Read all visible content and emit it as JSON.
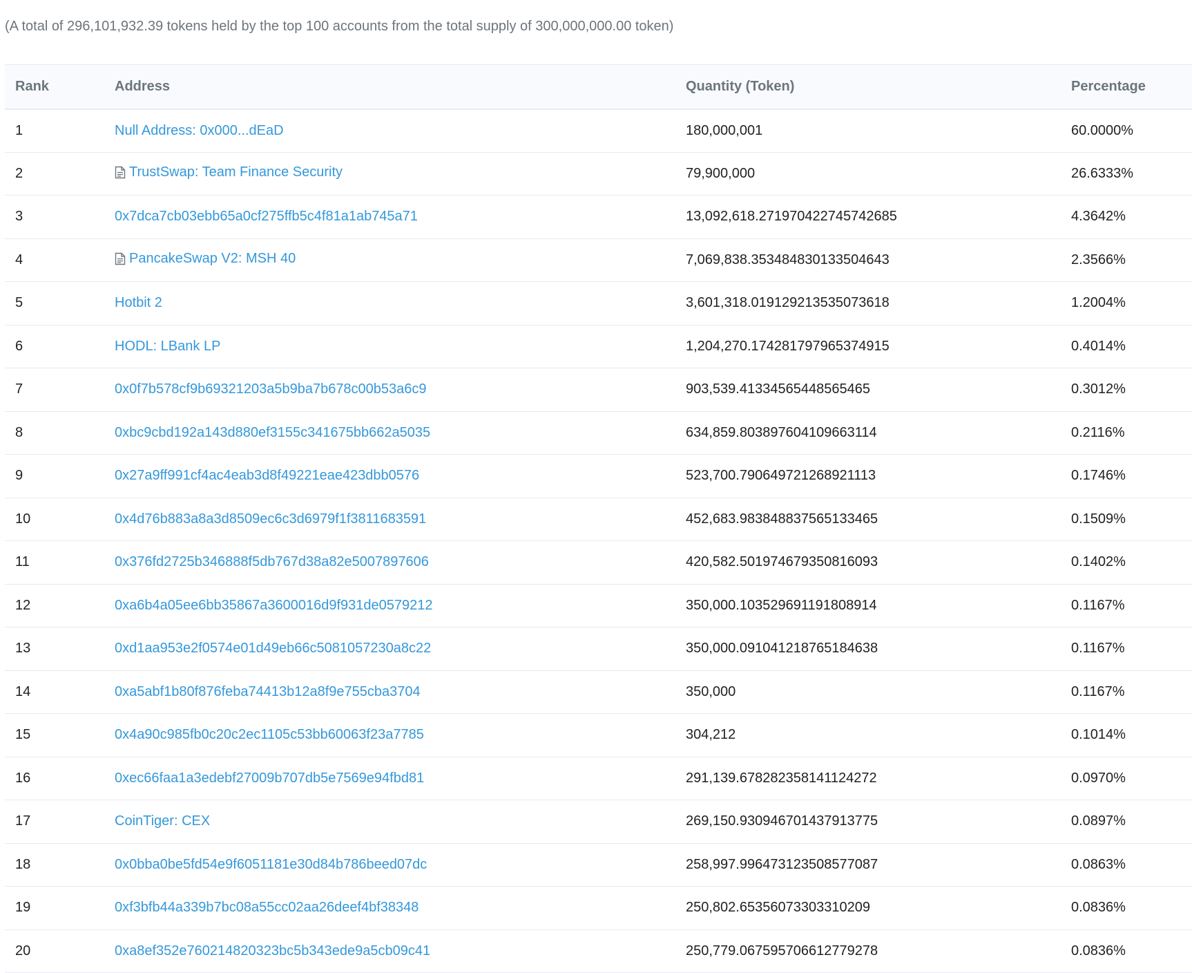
{
  "summary": "(A total of 296,101,932.39 tokens held by the top 100 accounts from the total supply of 300,000,000.00 token)",
  "table": {
    "headers": {
      "rank": "Rank",
      "address": "Address",
      "quantity": "Quantity (Token)",
      "percentage": "Percentage"
    },
    "rows": [
      {
        "rank": "1",
        "address": "Null Address: 0x000...dEaD",
        "contract": false,
        "quantity": "180,000,001",
        "percentage": "60.0000%"
      },
      {
        "rank": "2",
        "address": "TrustSwap: Team Finance Security",
        "contract": true,
        "quantity": "79,900,000",
        "percentage": "26.6333%"
      },
      {
        "rank": "3",
        "address": "0x7dca7cb03ebb65a0cf275ffb5c4f81a1ab745a71",
        "contract": false,
        "quantity": "13,092,618.271970422745742685",
        "percentage": "4.3642%"
      },
      {
        "rank": "4",
        "address": "PancakeSwap V2: MSH 40",
        "contract": true,
        "quantity": "7,069,838.353484830133504643",
        "percentage": "2.3566%"
      },
      {
        "rank": "5",
        "address": "Hotbit 2",
        "contract": false,
        "quantity": "3,601,318.019129213535073618",
        "percentage": "1.2004%"
      },
      {
        "rank": "6",
        "address": "HODL: LBank LP",
        "contract": false,
        "quantity": "1,204,270.174281797965374915",
        "percentage": "0.4014%"
      },
      {
        "rank": "7",
        "address": "0x0f7b578cf9b69321203a5b9ba7b678c00b53a6c9",
        "contract": false,
        "quantity": "903,539.41334565448565465",
        "percentage": "0.3012%"
      },
      {
        "rank": "8",
        "address": "0xbc9cbd192a143d880ef3155c341675bb662a5035",
        "contract": false,
        "quantity": "634,859.803897604109663114",
        "percentage": "0.2116%"
      },
      {
        "rank": "9",
        "address": "0x27a9ff991cf4ac4eab3d8f49221eae423dbb0576",
        "contract": false,
        "quantity": "523,700.790649721268921113",
        "percentage": "0.1746%"
      },
      {
        "rank": "10",
        "address": "0x4d76b883a8a3d8509ec6c3d6979f1f3811683591",
        "contract": false,
        "quantity": "452,683.983848837565133465",
        "percentage": "0.1509%"
      },
      {
        "rank": "11",
        "address": "0x376fd2725b346888f5db767d38a82e5007897606",
        "contract": false,
        "quantity": "420,582.501974679350816093",
        "percentage": "0.1402%"
      },
      {
        "rank": "12",
        "address": "0xa6b4a05ee6bb35867a3600016d9f931de0579212",
        "contract": false,
        "quantity": "350,000.103529691191808914",
        "percentage": "0.1167%"
      },
      {
        "rank": "13",
        "address": "0xd1aa953e2f0574e01d49eb66c5081057230a8c22",
        "contract": false,
        "quantity": "350,000.091041218765184638",
        "percentage": "0.1167%"
      },
      {
        "rank": "14",
        "address": "0xa5abf1b80f876feba74413b12a8f9e755cba3704",
        "contract": false,
        "quantity": "350,000",
        "percentage": "0.1167%"
      },
      {
        "rank": "15",
        "address": "0x4a90c985fb0c20c2ec1105c53bb60063f23a7785",
        "contract": false,
        "quantity": "304,212",
        "percentage": "0.1014%"
      },
      {
        "rank": "16",
        "address": "0xec66faa1a3edebf27009b707db5e7569e94fbd81",
        "contract": false,
        "quantity": "291,139.678282358141124272",
        "percentage": "0.0970%"
      },
      {
        "rank": "17",
        "address": "CoinTiger: CEX",
        "contract": false,
        "quantity": "269,150.930946701437913775",
        "percentage": "0.0897%"
      },
      {
        "rank": "18",
        "address": "0x0bba0be5fd54e9f6051181e30d84b786beed07dc",
        "contract": false,
        "quantity": "258,997.996473123508577087",
        "percentage": "0.0863%"
      },
      {
        "rank": "19",
        "address": "0xf3bfb44a339b7bc08a55cc02aa26deef4bf38348",
        "contract": false,
        "quantity": "250,802.65356073303310209",
        "percentage": "0.0836%"
      },
      {
        "rank": "20",
        "address": "0xa8ef352e760214820323bc5b343ede9a5cb09c41",
        "contract": false,
        "quantity": "250,779.067595706612779278",
        "percentage": "0.0836%"
      }
    ]
  },
  "colors": {
    "link": "#3498db",
    "header_text": "#6c757d",
    "border": "#e7eaf3"
  }
}
